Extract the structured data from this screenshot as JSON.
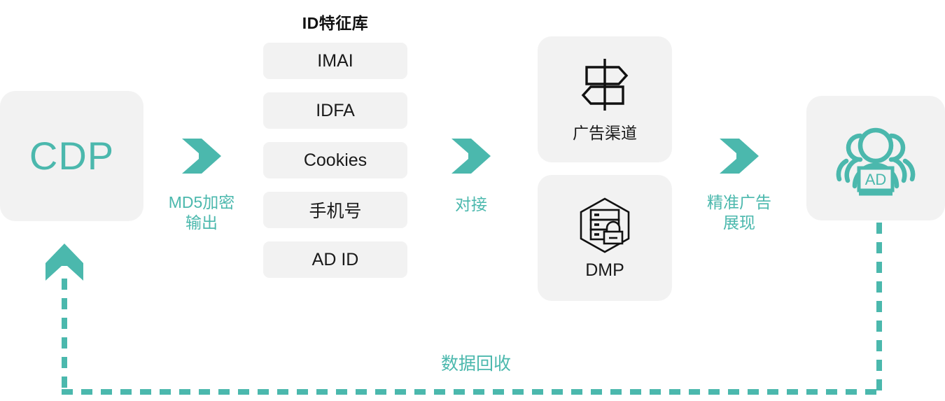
{
  "colors": {
    "accent": "#4bb8ad",
    "card_bg": "#f2f2f2",
    "text_dark": "#1a1a1a",
    "page_bg": "#ffffff"
  },
  "source": {
    "label": "CDP"
  },
  "steps": [
    {
      "id": "md5",
      "label": "MD5加密\n输出",
      "icon": "chevron-right-icon"
    },
    {
      "id": "docking",
      "label": "对接",
      "icon": "chevron-right-icon"
    },
    {
      "id": "precision-ad",
      "label": "精准广告\n展现",
      "icon": "chevron-right-icon"
    }
  ],
  "id_library": {
    "title": "ID特征库",
    "items": [
      {
        "label": "IMAI"
      },
      {
        "label": "IDFA"
      },
      {
        "label": "Cookies"
      },
      {
        "label": "手机号"
      },
      {
        "label": "AD ID"
      }
    ]
  },
  "channels": [
    {
      "id": "ad-channel",
      "label": "广告渠道",
      "icon": "signpost-icon"
    },
    {
      "id": "dmp",
      "label": "DMP",
      "icon": "hexagon-server-lock-icon"
    }
  ],
  "audience": {
    "icon": "audience-ad-icon",
    "badge_label": "AD"
  },
  "feedback": {
    "label": "数据回收",
    "arrow_icon": "arrow-up-icon",
    "line_style": "dashed"
  }
}
